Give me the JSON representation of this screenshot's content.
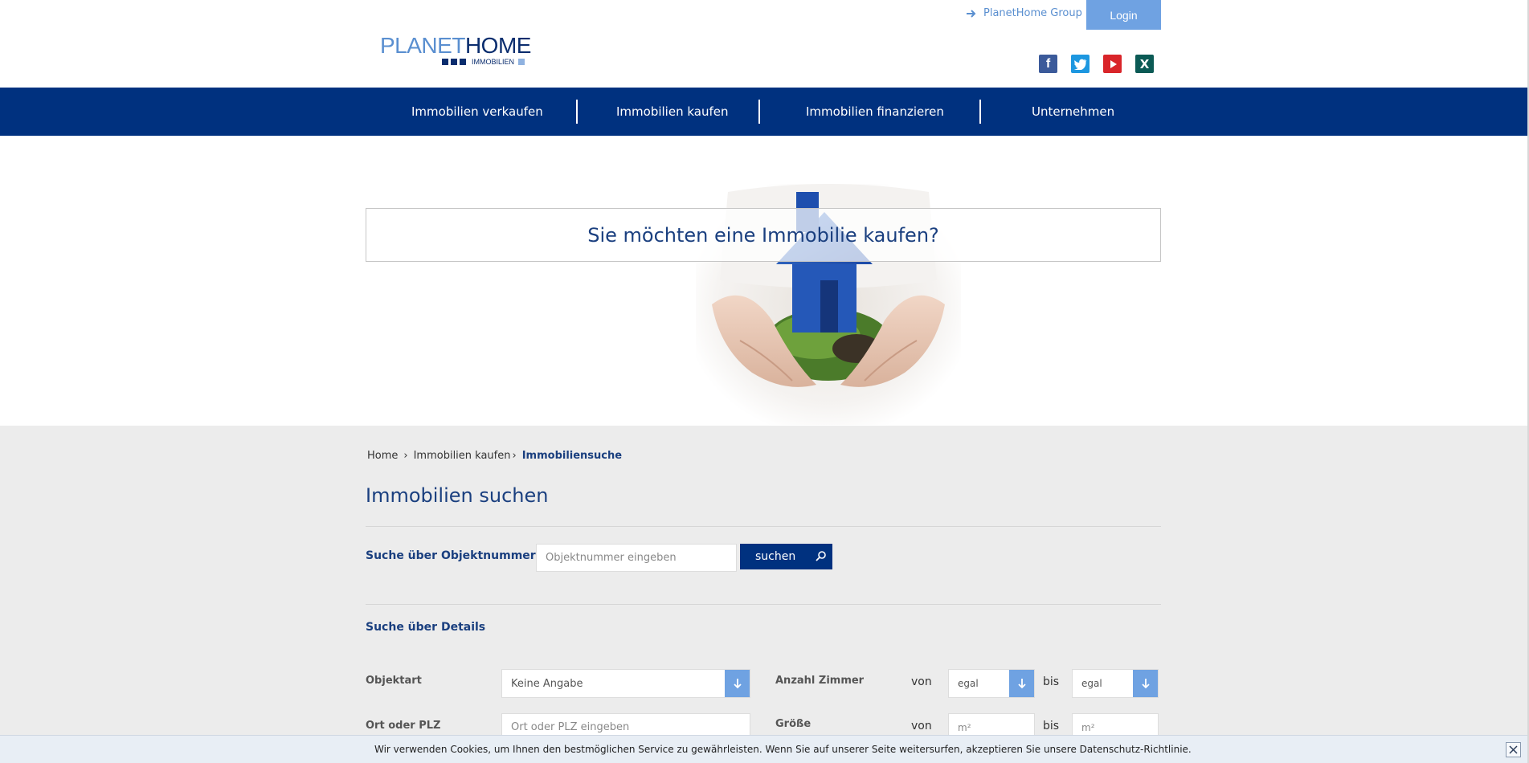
{
  "header": {
    "logo": {
      "planet": "PLANET",
      "home": "HOME",
      "sub": "IMMOBILIEN"
    },
    "group_link": "PlanetHome Group",
    "login": "Login",
    "social": [
      {
        "name": "facebook",
        "glyph": "f"
      },
      {
        "name": "twitter",
        "glyph": "t"
      },
      {
        "name": "youtube",
        "glyph": "▶"
      },
      {
        "name": "xing",
        "glyph": "X"
      }
    ]
  },
  "nav": {
    "items": [
      {
        "label": "Immobilien verkaufen"
      },
      {
        "label": "Immobilien kaufen"
      },
      {
        "label": "Immobilien finanzieren"
      },
      {
        "label": "Unternehmen"
      }
    ]
  },
  "hero": {
    "title": "Sie möchten eine Immobilie kaufen?"
  },
  "breadcrumb": {
    "home": "Home",
    "parent": "Immobilien kaufen",
    "current": "Immobiliensuche"
  },
  "search": {
    "title": "Immobilien suchen",
    "by_number_label": "Suche über Objektnummer",
    "number_placeholder": "Objektnummer eingeben",
    "search_button": "suchen",
    "by_details_label": "Suche über Details",
    "objektart_label": "Objektart",
    "objektart_value": "Keine Angabe",
    "rooms_label": "Anzahl Zimmer",
    "von": "von",
    "bis": "bis",
    "rooms_from": "egal",
    "rooms_to": "egal",
    "ort_label": "Ort oder PLZ",
    "ort_placeholder": "Ort oder PLZ eingeben",
    "size_label": "Größe",
    "size_from_placeholder": "m²",
    "size_to_placeholder": "m²"
  },
  "cookie": {
    "text": "Wir verwenden Cookies, um Ihnen den bestmöglichen Service zu gewährleisten. Wenn Sie auf unserer Seite weitersurfen, akzeptieren Sie unsere Datenschutz-Richtlinie.",
    "close": "×"
  },
  "colors": {
    "brand": "#00317f",
    "accent": "#6fa2e2",
    "title": "#1a3f7f",
    "background_grey": "#ececec"
  }
}
